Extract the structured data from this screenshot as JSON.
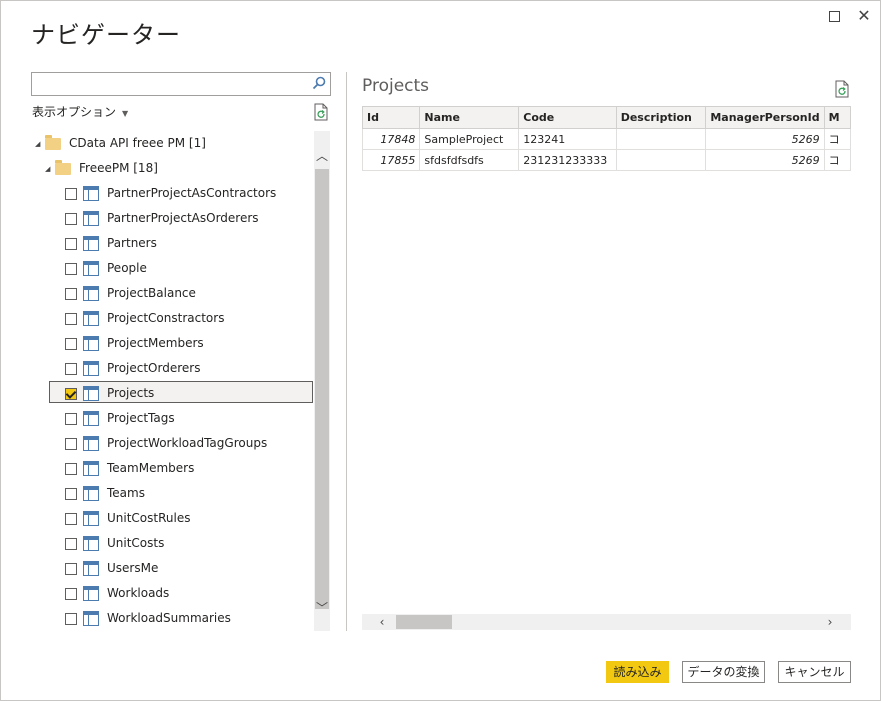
{
  "window": {
    "title": "ナビゲーター"
  },
  "left": {
    "search": {
      "value": "",
      "placeholder": ""
    },
    "display_options_label": "表示オプション",
    "tree": {
      "root": {
        "label": "CData API freee PM [1]"
      },
      "folder": {
        "label": "FreeePM [18]"
      },
      "tables": [
        {
          "label": "PartnerProjectAsContractors",
          "checked": false
        },
        {
          "label": "PartnerProjectAsOrderers",
          "checked": false
        },
        {
          "label": "Partners",
          "checked": false
        },
        {
          "label": "People",
          "checked": false
        },
        {
          "label": "ProjectBalance",
          "checked": false
        },
        {
          "label": "ProjectConstractors",
          "checked": false
        },
        {
          "label": "ProjectMembers",
          "checked": false
        },
        {
          "label": "ProjectOrderers",
          "checked": false
        },
        {
          "label": "Projects",
          "checked": true,
          "selected": true
        },
        {
          "label": "ProjectTags",
          "checked": false
        },
        {
          "label": "ProjectWorkloadTagGroups",
          "checked": false
        },
        {
          "label": "TeamMembers",
          "checked": false
        },
        {
          "label": "Teams",
          "checked": false
        },
        {
          "label": "UnitCostRules",
          "checked": false
        },
        {
          "label": "UnitCosts",
          "checked": false
        },
        {
          "label": "UsersMe",
          "checked": false
        },
        {
          "label": "Workloads",
          "checked": false
        },
        {
          "label": "WorkloadSummaries",
          "checked": false
        }
      ]
    }
  },
  "preview": {
    "title": "Projects",
    "columns": [
      "Id",
      "Name",
      "Code",
      "Description",
      "ManagerPersonId",
      "M"
    ],
    "rows": [
      [
        "17848",
        "SampleProject",
        "123241",
        "",
        "5269",
        "コ"
      ],
      [
        "17855",
        "sfdsfdfsdfs",
        "231231233333",
        "",
        "5269",
        "コ"
      ]
    ]
  },
  "buttons": {
    "load": "読み込み",
    "transform": "データの変換",
    "cancel": "キャンセル"
  }
}
